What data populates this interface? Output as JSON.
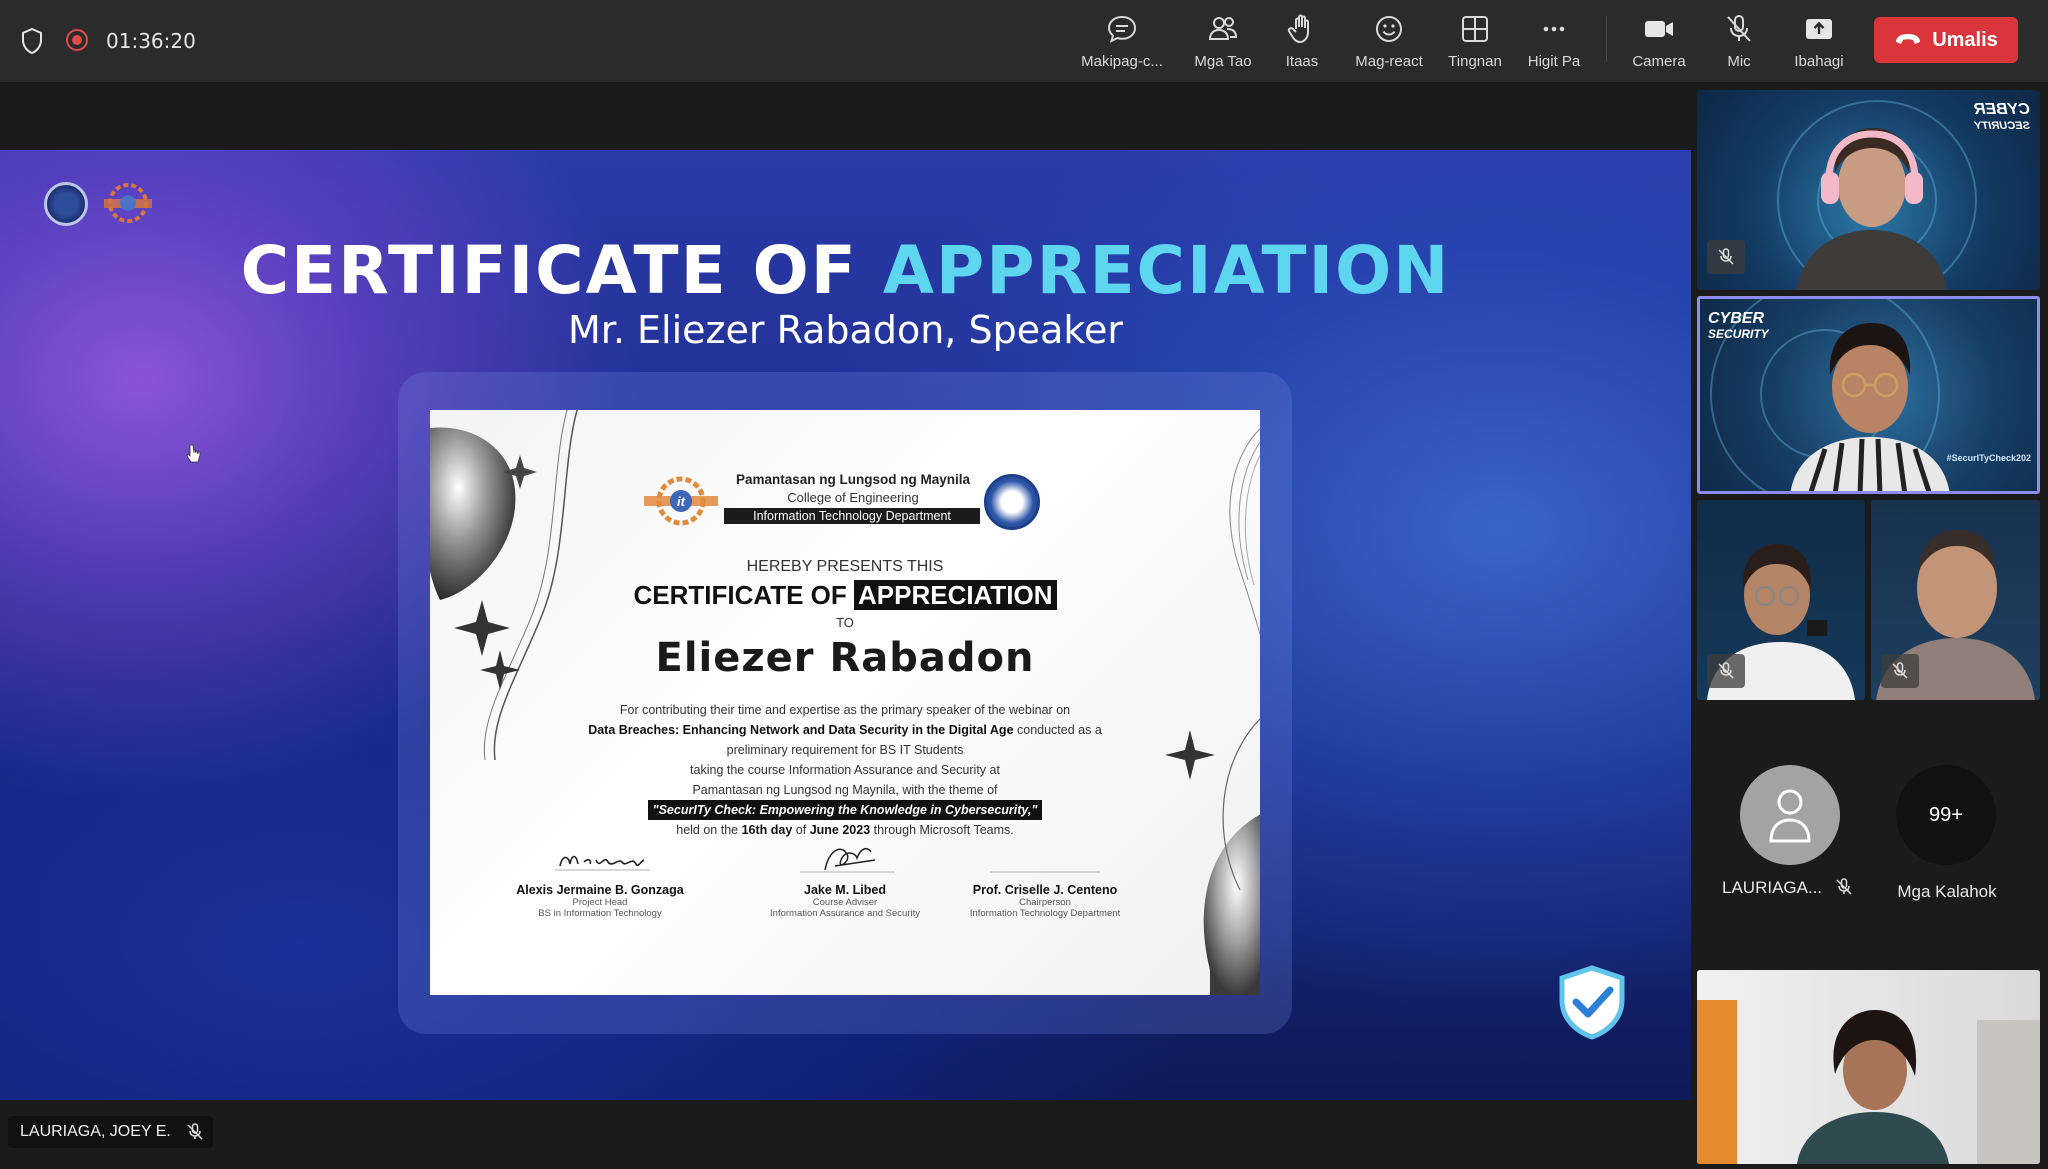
{
  "meeting": {
    "timer": "01:36:20",
    "toolbar": [
      {
        "label": "Makipag-c...",
        "icon": "chat-icon"
      },
      {
        "label": "Mga Tao",
        "icon": "people-icon"
      },
      {
        "label": "Itaas",
        "icon": "raise-hand-icon"
      },
      {
        "label": "Mag-react",
        "icon": "smiley-icon"
      },
      {
        "label": "Tingnan",
        "icon": "grid-view-icon"
      },
      {
        "label": "Higit Pa",
        "icon": "more-icon"
      },
      {
        "label": "Camera",
        "icon": "camera-icon"
      },
      {
        "label": "Mic",
        "icon": "mic-muted-icon"
      },
      {
        "label": "Ibahagi",
        "icon": "share-icon"
      }
    ],
    "leave_label": "Umalis",
    "leave_color": "#d9353a"
  },
  "slide": {
    "title_white": "CERTIFICATE OF",
    "title_cyan": "APPRECIATION",
    "subtitle": "Mr. Eliezer Rabadon, Speaker"
  },
  "certificate": {
    "university": "Pamantasan ng Lungsod ng Maynila",
    "college": "College of Engineering",
    "department": "Information Technology Department",
    "presents": "HEREBY PRESENTS THIS",
    "title_plain": "CERTIFICATE OF",
    "title_highlight": "APPRECIATION",
    "to": "TO",
    "recipient": "Eliezer Rabadon",
    "body_1": "For contributing their time and expertise as the primary speaker of the webinar on",
    "webinar_title": "Data Breaches: Enhancing Network and Data Security in the Digital Age",
    "body_2": " conducted as a",
    "body_3": "preliminary requirement for BS IT Students",
    "body_4": "taking the course Information Assurance and Security at",
    "body_5": "Pamantasan ng Lungsod ng Maynila, with the theme of",
    "theme": "\"SecurITy Check: Empowering the Knowledge in Cybersecurity,\"",
    "held_pre": "held on the ",
    "held_day": "16th day",
    "held_of": " of ",
    "held_month": "June 2023",
    "held_post": " through Microsoft Teams.",
    "signatories": [
      {
        "name": "Alexis Jermaine B. Gonzaga",
        "role_1": "Project Head",
        "role_2": "BS in Information Technology"
      },
      {
        "name": "Jake M. Libed",
        "role_1": "Course Adviser",
        "role_2": "Information Assurance and Security"
      },
      {
        "name": "Prof. Criselle J. Centeno",
        "role_1": "Chairperson",
        "role_2": "Information Technology Department"
      }
    ]
  },
  "speaker_tag": "LAURIAGA, JOEY E.",
  "participants": {
    "tile2_brand_1": "CYBER",
    "tile2_brand_2": "SECURITY",
    "tile1_brand_1": "CYBER",
    "tile1_brand_2": "SECURITY",
    "tile2_hashtag": "#SecurITyCheck202",
    "avatar_name": "LAURIAGA...",
    "more_count": "99+",
    "more_label": "Mga Kalahok"
  }
}
